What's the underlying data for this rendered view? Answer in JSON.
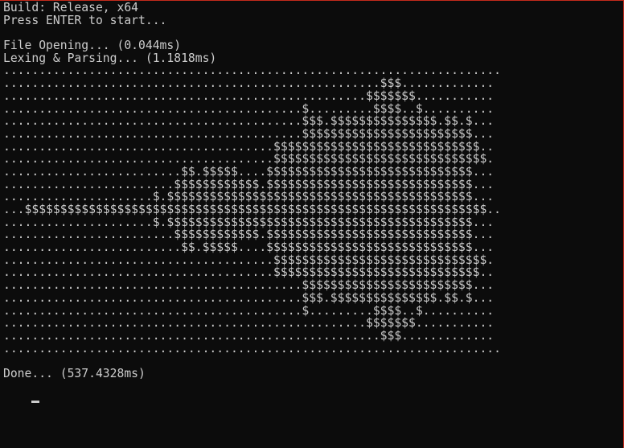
{
  "console": {
    "header": [
      "Build: Release, x64",
      "Press ENTER to start...",
      "",
      "File Opening... (0.044ms)",
      "Lexing & Parsing... (1.1818ms)"
    ],
    "mandelbrot_rows": [
      "......................................................................",
      ".....................................................$$$.............",
      "...................................................$$$$$$$...........",
      "..........................................$.........$$$$..$..........",
      "..........................................$$$.$$$$$$$$$$$$$$$.$$.$...",
      "..........................................$$$$$$$$$$$$$$$$$$$$$$$$...",
      "......................................$$$$$$$$$$$$$$$$$$$$$$$$$$$$$..",
      "......................................$$$$$$$$$$$$$$$$$$$$$$$$$$$$$$.",
      ".........................$$.$$$$$....$$$$$$$$$$$$$$$$$$$$$$$$$$$$$...",
      "........................$$$$$$$$$$$$.$$$$$$$$$$$$$$$$$$$$$$$$$$$$$...",
      ".....................$.$$$$$$$$$$$$$$$$$$$$$$$$$$$$$$$$$$$$$$$$$$$...",
      "...$$$$$$$$$$$$$$$$$$$$$$$$$$$$$$$$$$$$$$$$$$$$$$$$$$$$$$$$$$$$$$$$$..",
      ".....................$.$$$$$$$$$$$$$$$$$$$$$$$$$$$$$$$$$$$$$$$$$$$...",
      "........................$$$$$$$$$$$$.$$$$$$$$$$$$$$$$$$$$$$$$$$$$$...",
      ".........................$$.$$$$$....$$$$$$$$$$$$$$$$$$$$$$$$$$$$$...",
      "......................................$$$$$$$$$$$$$$$$$$$$$$$$$$$$$$.",
      "......................................$$$$$$$$$$$$$$$$$$$$$$$$$$$$$..",
      "..........................................$$$$$$$$$$$$$$$$$$$$$$$$...",
      "..........................................$$$.$$$$$$$$$$$$$$$.$$.$...",
      "..........................................$.........$$$$..$..........",
      "...................................................$$$$$$$...........",
      ".....................................................$$$.............",
      "......................................................................"
    ],
    "footer": "Done... (537.4328ms)"
  },
  "colors": {
    "background": "#0c0c0c",
    "text": "#cccccc",
    "window_border": "#c42b1c"
  }
}
